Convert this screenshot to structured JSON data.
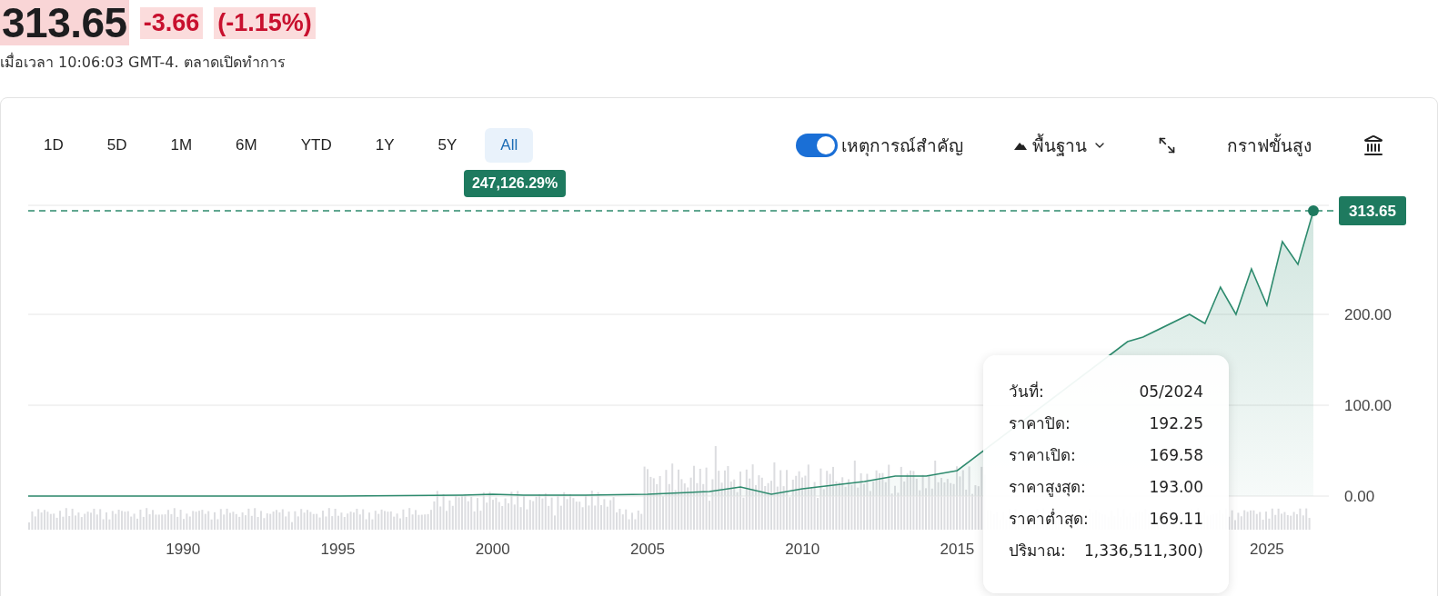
{
  "quote": {
    "price": "313.65",
    "change": "-3.66",
    "change_percent": "(-1.15%)",
    "timestamp": "เมื่อเวลา 10:06:03 GMT-4. ตลาดเปิดทำการ"
  },
  "ranges": [
    {
      "label": "1D",
      "selected": false
    },
    {
      "label": "5D",
      "selected": false
    },
    {
      "label": "1M",
      "selected": false
    },
    {
      "label": "6M",
      "selected": false
    },
    {
      "label": "YTD",
      "selected": false
    },
    {
      "label": "1Y",
      "selected": false
    },
    {
      "label": "5Y",
      "selected": false
    },
    {
      "label": "All",
      "selected": true
    }
  ],
  "range_return": "247,126.29%",
  "toolbar": {
    "events_toggle": {
      "label": "เหตุการณ์สำคัญ",
      "on": true
    },
    "chart_type": {
      "label": "พื้นฐาน"
    },
    "advanced_chart": {
      "label": "กราฟขั้นสูง"
    }
  },
  "chart": {
    "current_price_label": "313.65",
    "chart_data": {
      "type": "area",
      "xlim": [
        1985,
        2027
      ],
      "ylim": [
        0,
        320
      ],
      "grid": true,
      "ref_lines": [
        {
          "axis": "y",
          "value": 314
        }
      ],
      "x": [
        1985,
        1990,
        1995,
        1999,
        2000,
        2001,
        2003,
        2005,
        2007,
        2008,
        2009,
        2010,
        2011,
        2012,
        2013,
        2014,
        2015,
        2020.5,
        2021,
        2022.5,
        2023,
        2023.5,
        2024,
        2024.5,
        2025,
        2025.5,
        2026,
        2026.5
      ],
      "series": [
        {
          "color": "#2e8b6e",
          "values": [
            0,
            0,
            0,
            1,
            2,
            1,
            1,
            2,
            5,
            10,
            2,
            8,
            12,
            16,
            22,
            22,
            28,
            170,
            175,
            200,
            190,
            230,
            200,
            250,
            210,
            280,
            255,
            314
          ]
        }
      ],
      "xticks": [
        1990,
        1995,
        2000,
        2005,
        2010,
        2015,
        2025
      ],
      "yticks": [
        {
          "value": 0,
          "label": "0.00"
        },
        {
          "value": 100,
          "label": "100.00"
        },
        {
          "value": 200,
          "label": "200.00"
        }
      ]
    }
  },
  "tooltip": {
    "rows": [
      {
        "label": "วันที่:",
        "value": "05/2024"
      },
      {
        "label": "ราคาปิด:",
        "value": "192.25"
      },
      {
        "label": "ราคาเปิด:",
        "value": "169.58"
      },
      {
        "label": "ราคาสูงสุด:",
        "value": "193.00"
      },
      {
        "label": "ราคาต่ำสุด:",
        "value": "169.11"
      },
      {
        "label": "ปริมาณ:",
        "value": "1,336,511,300)"
      }
    ]
  }
}
